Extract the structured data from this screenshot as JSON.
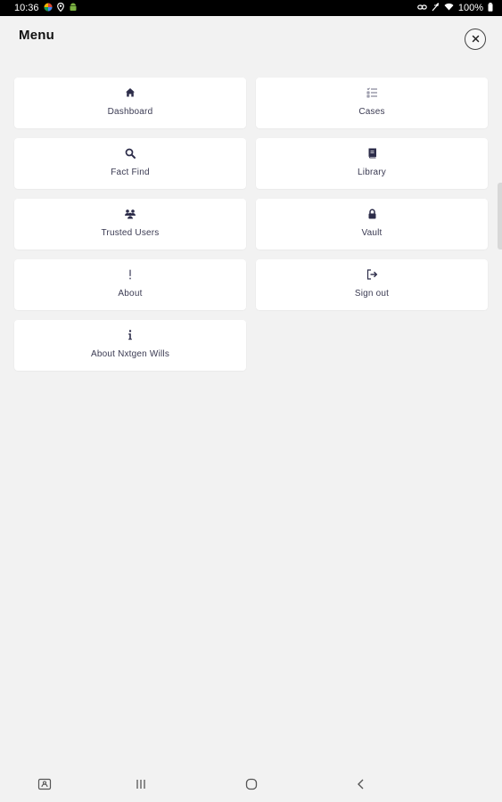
{
  "status_bar": {
    "time": "10:36",
    "battery": "100%",
    "left_icons": [
      "colorful-app-icon",
      "location-icon",
      "android-icon"
    ],
    "right_icons": [
      "link-icon",
      "mute-icon",
      "wifi-icon",
      "battery-icon"
    ]
  },
  "header": {
    "title": "Menu",
    "close_icon": "close-icon"
  },
  "menu": {
    "items": [
      {
        "label": "Dashboard",
        "icon": "home-icon"
      },
      {
        "label": "Cases",
        "icon": "list-icon"
      },
      {
        "label": "Fact Find",
        "icon": "search-icon"
      },
      {
        "label": "Library",
        "icon": "book-icon"
      },
      {
        "label": "Trusted Users",
        "icon": "users-icon"
      },
      {
        "label": "Vault",
        "icon": "lock-icon"
      },
      {
        "label": "About",
        "icon": "exclamation-icon"
      },
      {
        "label": "Sign out",
        "icon": "sign-out-icon"
      },
      {
        "label": "About Nxtgen Wills",
        "icon": "info-icon"
      }
    ]
  },
  "nav_bar": {
    "buttons": [
      "assistant-icon",
      "recents-icon",
      "home-circle-icon",
      "back-icon"
    ]
  },
  "colors": {
    "background": "#f2f2f2",
    "card": "#ffffff",
    "icon": "#2d2d4a",
    "status_bar": "#000000"
  }
}
